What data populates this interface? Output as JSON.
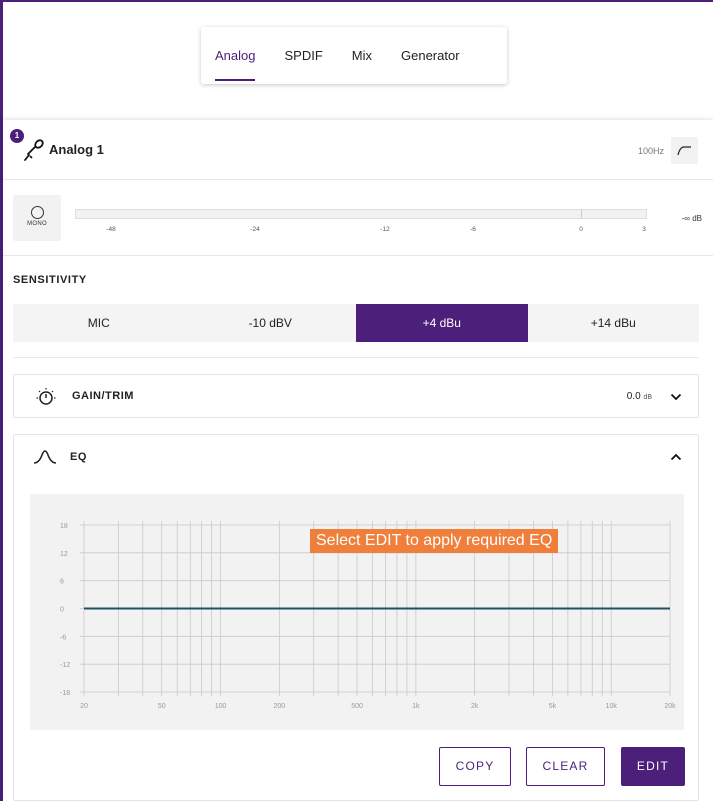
{
  "tabs": [
    {
      "label": "Analog",
      "active": true
    },
    {
      "label": "SPDIF",
      "active": false
    },
    {
      "label": "Mix",
      "active": false
    },
    {
      "label": "Generator",
      "active": false
    }
  ],
  "channel": {
    "badge": "1",
    "title": "Analog 1",
    "hpf_label": "100Hz"
  },
  "meter": {
    "mono_label": "MONO",
    "ticks": [
      "-48",
      "-24",
      "-12",
      "-6",
      "0",
      "3"
    ],
    "value": "-∞ dB"
  },
  "sensitivity": {
    "title": "SENSITIVITY",
    "options": [
      "MIC",
      "-10 dBV",
      "+4 dBu",
      "+14 dBu"
    ],
    "selected": "+4 dBu"
  },
  "gain": {
    "title": "GAIN/TRIM",
    "value": "0.0",
    "unit": "dB"
  },
  "eq": {
    "title": "EQ",
    "message": "Select EDIT to apply required EQ",
    "y_ticks": [
      "18",
      "12",
      "6",
      "0",
      "-6",
      "-12",
      "-18"
    ],
    "x_ticks": [
      "20",
      "50",
      "100",
      "200",
      "500",
      "1k",
      "2k",
      "5k",
      "10k",
      "20k"
    ],
    "buttons": {
      "copy": "COPY",
      "clear": "CLEAR",
      "edit": "EDIT"
    }
  },
  "colors": {
    "accent": "#4b1f7a",
    "message_bg": "#f07f3c",
    "eq_line": "#1f4f63"
  },
  "chart_data": {
    "type": "line",
    "title": "",
    "xlabel": "",
    "ylabel": "",
    "x_scale": "log",
    "xlim": [
      20,
      20000
    ],
    "ylim": [
      -18,
      18
    ],
    "grid": true,
    "series": [
      {
        "x": [
          20,
          20000
        ],
        "y": [
          0,
          0
        ]
      }
    ]
  }
}
